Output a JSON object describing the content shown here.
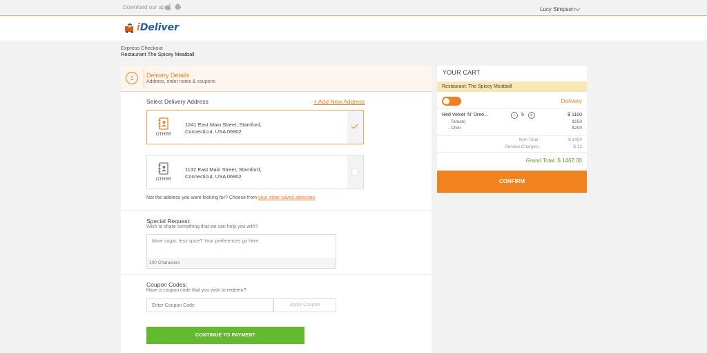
{
  "topbar": {
    "download_label": "Download our app:",
    "user_name": "Lucy Simpson"
  },
  "header": {
    "logo_text_prefix": "i",
    "logo_text_rest": "Deliver"
  },
  "breadcrumb": {
    "line1": "Express Checkout",
    "line2": "Restaurant The Spicey Meatball"
  },
  "step": {
    "number": "1",
    "title": "Delivery Details",
    "subtitle": "Address, order notes & coupons"
  },
  "address_section": {
    "label": "Select Delivery Address",
    "add_link": "+ Add New Address",
    "addresses": [
      {
        "type": "OTHER",
        "line1": "1241 East Main Street, Stamford,",
        "line2": "Connecticut, USA 06902",
        "selected": true
      },
      {
        "type": "OTHER",
        "line1": "1132 East Main Street, Stamford,",
        "line2": "Connecticut, USA 06902",
        "selected": false
      }
    ],
    "not_found_text": "Not the address you were looking for? Choose from ",
    "not_found_link": "your other saved adresses"
  },
  "special_request": {
    "title": "Special Request:",
    "subtitle": "Wish to share something that we can help you with?",
    "placeholder": "More sugar, less spice? Your preferences go here.",
    "char_count": "100 Characters"
  },
  "coupon": {
    "title": "Coupon Codes:",
    "subtitle": "Have a coupon code that you wish to redeem?",
    "placeholder": "Enter Coupon Code",
    "apply_label": "Apply Coupon"
  },
  "continue_label": "CONTINUE TO PAYMENT",
  "cart": {
    "title": "YOUR CART",
    "restaurant": "Restaurant: The Spicey Meatball",
    "mode_label": "Delivery",
    "item": {
      "name": "Red Velvet 'N' Oreo...",
      "qty": "5",
      "price": "$ 1100"
    },
    "addons": [
      {
        "name": "- Tomato",
        "price": "$150"
      },
      {
        "name": "- Chilli",
        "price": "$200"
      }
    ],
    "item_total_label": "Item Total :",
    "item_total": "$ 1450",
    "service_label": "Service Charges :",
    "service": "$ 12",
    "grand_total": "Grand Total: $ 1462.00",
    "confirm_label": "CONFIRM"
  },
  "colors": {
    "accent": "#ee7f22",
    "success": "#63b92f",
    "brand_blue": "#1f5aa8"
  }
}
